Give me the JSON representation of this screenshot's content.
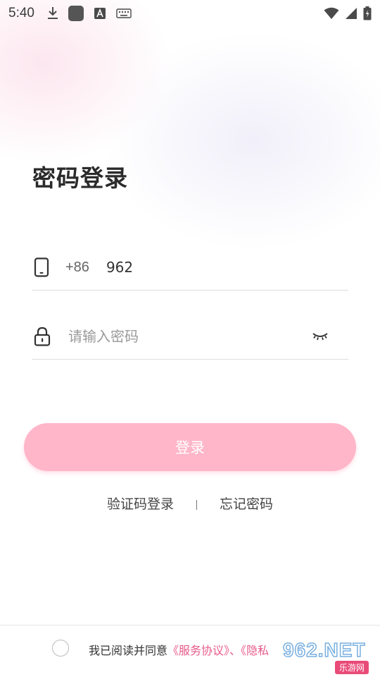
{
  "status_bar": {
    "time": "5:40",
    "icons_left": [
      "download-icon",
      "app-square-icon",
      "font-a-icon",
      "keyboard-icon"
    ],
    "icons_right": [
      "wifi-icon",
      "signal-icon",
      "battery-icon"
    ]
  },
  "page": {
    "title": "密码登录"
  },
  "phone_field": {
    "icon": "phone-icon",
    "prefix": "+86",
    "value": "962"
  },
  "password_field": {
    "icon": "lock-icon",
    "placeholder": "请输入密码",
    "toggle_icon": "eye-closed-icon"
  },
  "login_button": {
    "label": "登录",
    "color": "#ffb6c9"
  },
  "links": {
    "sms_login": "验证码登录",
    "forgot_password": "忘记密码"
  },
  "agreement": {
    "prefix": "我已阅读并同意",
    "service_link": "《服务协议》",
    "separator": "、",
    "privacy_link": "《隐私",
    "link_color": "#e85a8b"
  },
  "watermark": {
    "brand": "962.NET",
    "subtitle": "乐游网"
  }
}
